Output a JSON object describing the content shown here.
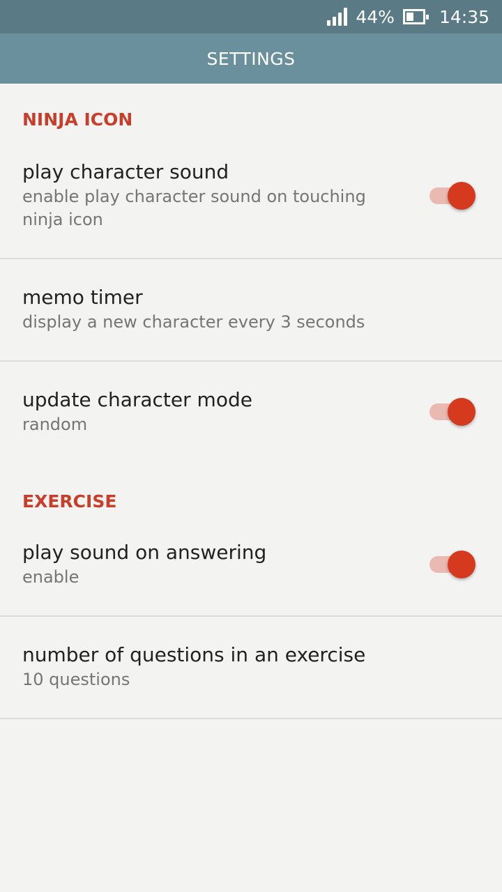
{
  "status_bar": {
    "battery_percent": "44%",
    "battery_level": 0.44,
    "time": "14:35",
    "signal_icon": "signal-icon",
    "battery_icon": "battery-icon"
  },
  "app_bar": {
    "title": "SETTINGS"
  },
  "colors": {
    "accent": "#d63a1e",
    "section_header": "#c73e2a",
    "app_bar": "#6b909d",
    "status_bar": "#5a7a86"
  },
  "sections": {
    "ninja_icon": {
      "header": "NINJA ICON",
      "play_character_sound": {
        "title": "play character sound",
        "summary": "enable play character sound on touching ninja icon",
        "enabled": true
      },
      "memo_timer": {
        "title": "memo timer",
        "summary": "display a new character every 3 seconds"
      },
      "update_character_mode": {
        "title": "update character mode",
        "summary": "random",
        "enabled": true
      }
    },
    "exercise": {
      "header": "EXERCISE",
      "play_sound_on_answering": {
        "title": "play sound on answering",
        "summary": "enable",
        "enabled": true
      },
      "number_of_questions": {
        "title": "number of questions in an exercise",
        "summary": "10 questions"
      }
    }
  }
}
